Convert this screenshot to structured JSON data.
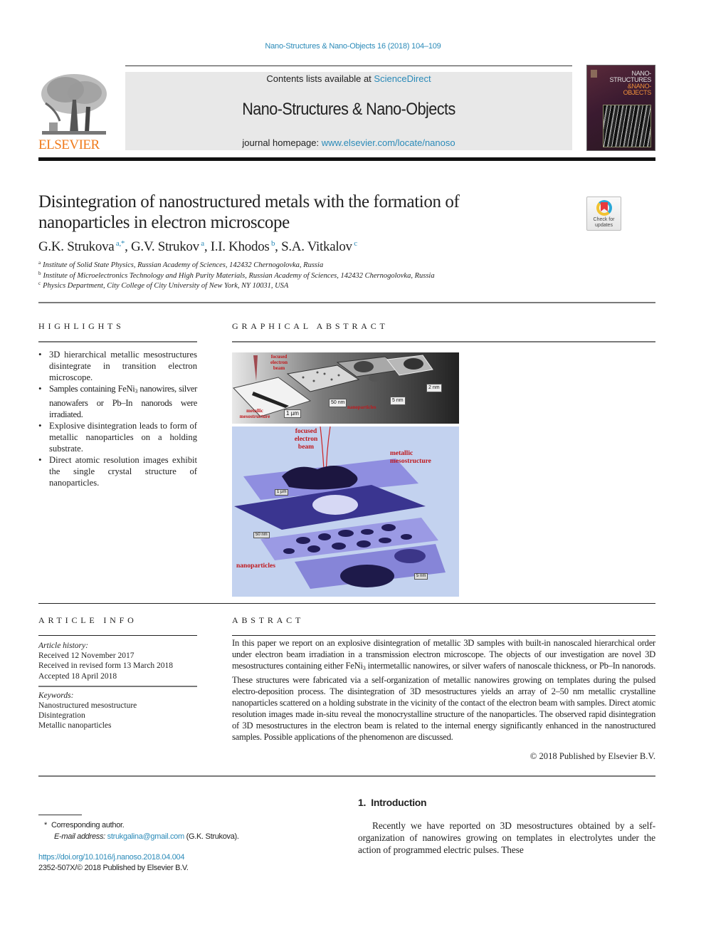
{
  "running_head": "Nano-Structures & Nano-Objects 16 (2018) 104–109",
  "masthead": {
    "publisher": "ELSEVIER",
    "contents_prefix": "Contents lists available at ",
    "contents_link": "ScienceDirect",
    "journal_name": "Nano-Structures & Nano-Objects",
    "homepage_prefix": "journal homepage: ",
    "homepage_link": "www.elsevier.com/locate/nanoso",
    "cover_title_lines": [
      "NANO-",
      "STRUCTURES",
      "&NANO-",
      "OBJECTS"
    ],
    "brand_color": "#f07a1a",
    "link_color": "#2a8ab8"
  },
  "article": {
    "title_line1": "Disintegration of nanostructured metals with the formation of",
    "title_line2": "nanoparticles in electron microscope",
    "check_updates_line1": "Check for",
    "check_updates_line2": "updates",
    "authors": [
      {
        "name": "G.K. Strukova",
        "sup": "a,*",
        "sep": ", "
      },
      {
        "name": "G.V. Strukov",
        "sup": "a",
        "sep": ", "
      },
      {
        "name": "I.I. Khodos",
        "sup": "b",
        "sep": ", "
      },
      {
        "name": "S.A. Vitkalov",
        "sup": "c",
        "sep": ""
      }
    ],
    "affiliations": [
      {
        "key": "a",
        "text": "Institute of Solid State Physics, Russian Academy of Sciences, 142432 Chernogolovka, Russia"
      },
      {
        "key": "b",
        "text": "Institute of Microelectronics Technology and High Purity Materials, Russian Academy of Sciences, 142432 Chernogolovka, Russia"
      },
      {
        "key": "c",
        "text": "Physics Department, City College of City University of New York, NY 10031, USA"
      }
    ]
  },
  "highlights": {
    "heading": "HIGHLIGHTS",
    "items": [
      {
        "text": "3D hierarchical metallic mesostructures disintegrate in transition electron microscope."
      },
      {
        "pre": "Samples containing FeNi",
        "sub": "3",
        "post": " nanowires, silver nanowafers or Pb–In nanorods were irradiated."
      },
      {
        "text": "Explosive disintegration leads to form of metallic nanoparticles on a holding substrate."
      },
      {
        "text": "Direct atomic resolution images exhibit the single crystal structure of nanoparticles."
      }
    ]
  },
  "graphical_abstract": {
    "heading": "GRAPHICAL ABSTRACT",
    "top_panel": {
      "label_beam": "focused electron beam",
      "label_meso": "metallic mesostructure",
      "label_np": "nanoparticles",
      "scale_1": "1 µm",
      "scale_2": "50 nm",
      "scale_3": "5 nm",
      "scale_4": "2 nm"
    },
    "bottom_panel": {
      "label_beam": "focused electron beam",
      "label_meso": "metallic mesostructure",
      "label_np": "nanoparticles",
      "scale_1": "1 µm",
      "scale_2": "50 nm",
      "scale_3": "5 nm"
    }
  },
  "article_info": {
    "heading": "ARTICLE INFO",
    "history_label": "Article history:",
    "history": [
      "Received 12 November 2017",
      "Received in revised form 13 March 2018",
      "Accepted 18 April 2018"
    ],
    "keywords_label": "Keywords:",
    "keywords": [
      "Nanostructured mesostructure",
      "Disintegration",
      "Metallic nanoparticles"
    ]
  },
  "abstract": {
    "heading": "ABSTRACT",
    "part1": "In this paper we report on an explosive disintegration of metallic 3D samples with built-in nanoscaled hierarchical order under electron beam irradiation in a transmission electron microscope. The objects of our investigation are novel 3D mesostructures containing either FeNi",
    "sub": "3",
    "part2": " intermetallic nanowires, or silver wafers of nanoscale thickness, or Pb–In nanorods. These structures were fabricated via a self-organization of metallic nanowires growing on templates during the pulsed electro-deposition process. The disintegration of 3D mesostructures yields an array of 2–50 nm metallic crystalline nanoparticles scattered on a holding substrate in the vicinity of the contact of the electron beam with samples. Direct atomic resolution images made in-situ reveal the monocrystalline structure of the nanoparticles. The observed rapid disintegration of 3D mesostructures in the electron beam is related to the internal energy significantly enhanced in the nanostructured samples. Possible applications of the phenomenon are discussed.",
    "copyright": "© 2018 Published by Elsevier B.V."
  },
  "footnote": {
    "marker": "*",
    "corresponding": "Corresponding author.",
    "email_label": "E-mail address: ",
    "email": "strukgalina@gmail.com",
    "email_suffix": " (G.K. Strukova).",
    "doi": "https://doi.org/10.1016/j.nanoso.2018.04.004",
    "issn": "2352-507X/© 2018 Published by Elsevier B.V."
  },
  "introduction": {
    "heading": "1.  Introduction",
    "text": "Recently we have reported on 3D mesostructures obtained by a self-organization of nanowires growing on templates in electrolytes under the action of programmed electric pulses. These"
  }
}
